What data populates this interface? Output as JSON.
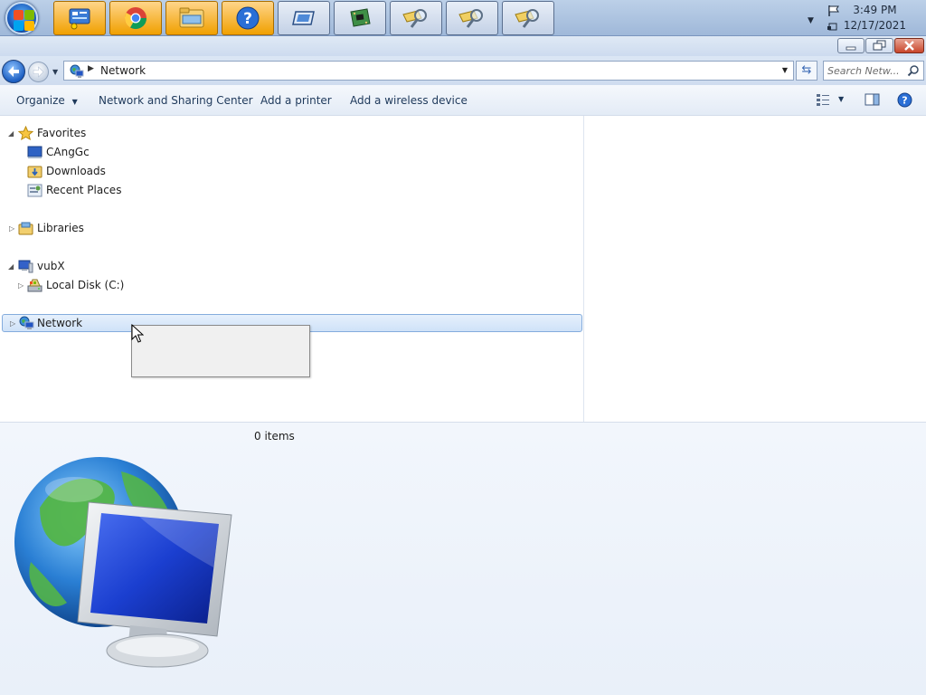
{
  "taskbar": {
    "buttons": [
      {
        "name": "control-panel",
        "active": true
      },
      {
        "name": "chrome",
        "active": true
      },
      {
        "name": "file-manager",
        "active": true
      },
      {
        "name": "help",
        "active": true
      },
      {
        "name": "remote-window",
        "active": false
      },
      {
        "name": "device-manager",
        "active": false
      },
      {
        "name": "search-folder-1",
        "active": false
      },
      {
        "name": "search-folder-2",
        "active": false
      },
      {
        "name": "search-folder-3",
        "active": false
      }
    ],
    "clock_time": "3:49 PM",
    "clock_date": "12/17/2021"
  },
  "address": {
    "location": "Network",
    "search_placeholder": "Search Netw..."
  },
  "toolbar": {
    "organize": "Organize",
    "network_sharing": "Network and Sharing Center",
    "add_printer": "Add a printer",
    "add_wireless": "Add a wireless device"
  },
  "nav": {
    "favorites": "Favorites",
    "favorites_items": [
      "CAngGc",
      "Downloads",
      "Recent Places"
    ],
    "libraries": "Libraries",
    "computer": "vubX",
    "local_disk": "Local Disk (C:)",
    "network": "Network"
  },
  "details": {
    "count": "0 items"
  },
  "colors": {
    "accent": "#1e395b",
    "selection": "#cfe2f8",
    "taskbar": "#a9c0df"
  }
}
